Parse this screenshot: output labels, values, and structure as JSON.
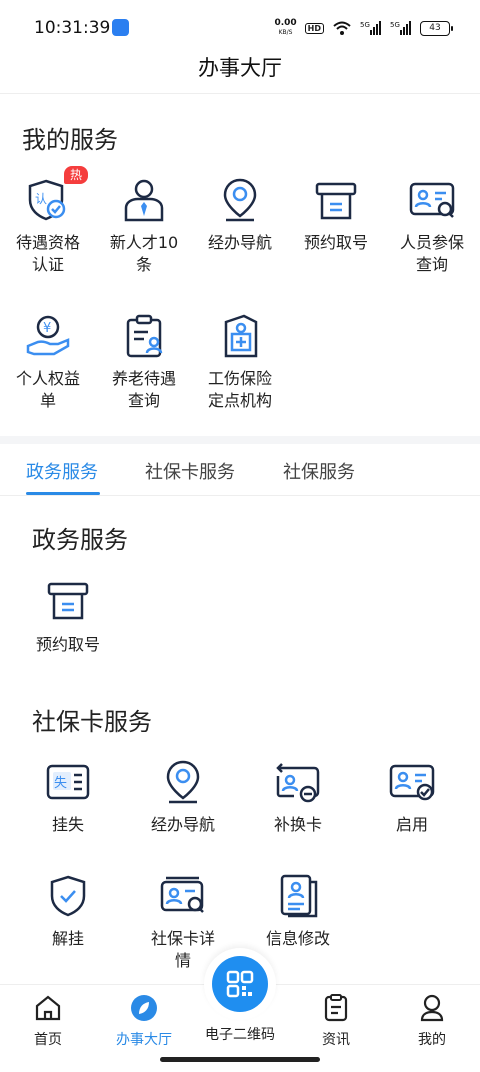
{
  "status_bar": {
    "time": "10:31:39",
    "net_speed": "0.00",
    "net_unit": "KB/S",
    "hd": "HD",
    "signal1": "5G",
    "signal2": "5G",
    "battery": "43"
  },
  "header": {
    "title": "办事大厅"
  },
  "my_services": {
    "heading": "我的服务",
    "hot_badge": "热",
    "items": [
      {
        "label": "待遇资格认证",
        "icon": "shield-check-icon"
      },
      {
        "label": "新人才10条",
        "icon": "person-icon"
      },
      {
        "label": "经办导航",
        "icon": "location-pin-icon"
      },
      {
        "label": "预约取号",
        "icon": "ticket-machine-icon"
      },
      {
        "label": "人员参保查询",
        "icon": "id-card-search-icon"
      },
      {
        "label": "个人权益单",
        "icon": "hand-coin-icon"
      },
      {
        "label": "养老待遇查询",
        "icon": "clipboard-person-icon"
      },
      {
        "label": "工伤保险定点机构",
        "icon": "hospital-doc-icon"
      }
    ]
  },
  "tabs": [
    {
      "label": "政务服务"
    },
    {
      "label": "社保卡服务"
    },
    {
      "label": "社保服务"
    }
  ],
  "gov_services": {
    "heading": "政务服务",
    "items": [
      {
        "label": "预约取号",
        "icon": "ticket-machine-icon"
      }
    ]
  },
  "card_services": {
    "heading": "社保卡服务",
    "items": [
      {
        "label": "挂失",
        "icon": "card-lost-icon"
      },
      {
        "label": "经办导航",
        "icon": "location-pin-icon"
      },
      {
        "label": "补换卡",
        "icon": "card-replace-icon"
      },
      {
        "label": "启用",
        "icon": "card-activate-icon"
      },
      {
        "label": "解挂",
        "icon": "shield-check-icon"
      },
      {
        "label": "社保卡详情",
        "icon": "card-search-icon"
      },
      {
        "label": "信息修改",
        "icon": "document-edit-icon"
      }
    ]
  },
  "bottom_nav": [
    {
      "label": "首页",
      "icon": "home-icon"
    },
    {
      "label": "办事大厅",
      "icon": "compass-icon"
    },
    {
      "label": "电子二维码",
      "icon": "qr-code-icon"
    },
    {
      "label": "资讯",
      "icon": "news-icon"
    },
    {
      "label": "我的",
      "icon": "profile-icon"
    }
  ],
  "colors": {
    "accent": "#2a8ae6",
    "icon_dark": "#1d2a44",
    "icon_blue": "#3b8ef0",
    "hot": "#f53d3d"
  }
}
